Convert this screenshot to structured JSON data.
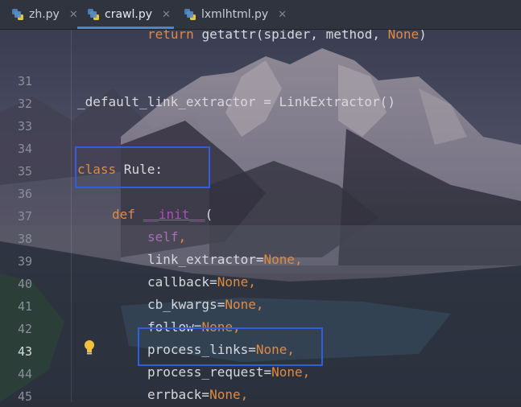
{
  "tabs": [
    {
      "label": "zh.py",
      "active": false
    },
    {
      "label": "crawl.py",
      "active": true
    },
    {
      "label": "lxmlhtml.py",
      "active": false
    }
  ],
  "lines": [
    {
      "num": "",
      "text": "return getattr(spider, method, None)"
    },
    {
      "num": "31",
      "text": ""
    },
    {
      "num": "32",
      "text": "_default_link_extractor = LinkExtractor()"
    },
    {
      "num": "33",
      "text": ""
    },
    {
      "num": "34",
      "text": ""
    },
    {
      "num": "35",
      "text": "class Rule:"
    },
    {
      "num": "36",
      "text": ""
    },
    {
      "num": "37",
      "text": "def __init__("
    },
    {
      "num": "38",
      "text": "self,"
    },
    {
      "num": "39",
      "text": "link_extractor=None,"
    },
    {
      "num": "40",
      "text": "callback=None,"
    },
    {
      "num": "41",
      "text": "cb_kwargs=None,"
    },
    {
      "num": "42",
      "text": "follow=None,"
    },
    {
      "num": "43",
      "text": "process_links=None,"
    },
    {
      "num": "44",
      "text": "process_request=None,"
    },
    {
      "num": "45",
      "text": "errback=None,"
    }
  ],
  "tokens": {
    "return": "return",
    "getattr": "getattr(spider, method, ",
    "none": "None",
    "close_paren": ")",
    "default_extractor": "_default_link_extractor = LinkExtractor()",
    "class_kw": "class",
    "rule_name": " Rule:",
    "def_kw": "def",
    "init_name": "__init__",
    "open_paren": "(",
    "self": "self",
    "comma": ",",
    "link_extractor": "link_extractor=",
    "callback": "callback=",
    "cb_kwargs": "cb_kwargs=",
    "follow": "follow=",
    "process_links": "process_links=",
    "process_request": "process_request=",
    "errback": "errback="
  },
  "current_line": "43",
  "colors": {
    "keyword": "#e2893e",
    "self": "#a46fb3",
    "dunder": "#b04cbf",
    "highlight_box": "#2f5fe0",
    "tab_underline": "#4a88c7"
  },
  "icons": {
    "tab_file": "python-file-icon",
    "tab_close": "close-icon",
    "gutter_hint": "lightbulb-icon"
  }
}
